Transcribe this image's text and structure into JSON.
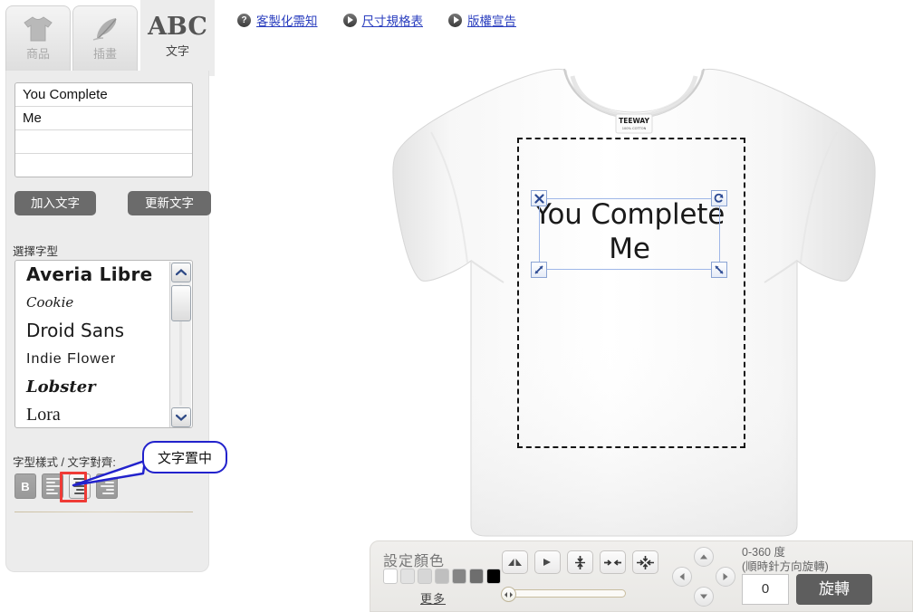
{
  "tabs": [
    {
      "id": "product",
      "label": "商品",
      "icon": "tshirt-icon",
      "active": false
    },
    {
      "id": "illustration",
      "label": "插畫",
      "icon": "feather-icon",
      "active": false
    },
    {
      "id": "text",
      "label": "文字",
      "icon": "abc-icon",
      "glyph": "ABC",
      "active": true
    }
  ],
  "top_links": [
    {
      "label": "客製化需知",
      "icon": "question-mark-icon"
    },
    {
      "label": "尺寸規格表",
      "icon": "play-icon"
    },
    {
      "label": "版權宣告",
      "icon": "play-icon"
    }
  ],
  "text_editor": {
    "lines": [
      "You Complete",
      "Me",
      "",
      ""
    ],
    "add_button": "加入文字",
    "update_button": "更新文字"
  },
  "font_section": {
    "label": "選擇字型",
    "fonts": [
      "Averia Libre",
      "Cookie",
      "Droid Sans",
      "Indie Flower",
      "Lobster",
      "Lora"
    ],
    "scroll_up": "▲",
    "scroll_down": "▼"
  },
  "style_section": {
    "label": "字型樣式 / 文字對齊:",
    "bold_label": "B",
    "buttons": [
      "bold",
      "align-left",
      "align-center",
      "align-right"
    ],
    "selected": "align-center",
    "tooltip": "文字置中",
    "highlight_color": "#ef3b36",
    "tooltip_border_color": "#2222cc"
  },
  "canvas": {
    "design_text_line1": "You Complete",
    "design_text_line2": "Me",
    "handles": {
      "close": "✕",
      "rotate": "↻",
      "resize_bl": "⤡",
      "resize_br": "⤢"
    },
    "print_area_style": "dashed"
  },
  "bottom_bar": {
    "color_label": "設定顏色",
    "more_label": "更多",
    "swatches": [
      "#ffffff",
      "#e2e2e2",
      "#d6d6d6",
      "#bfbfbf",
      "#858585",
      "#6e6e6e",
      "#000000"
    ],
    "tools": [
      {
        "name": "flip-horizontal-icon"
      },
      {
        "name": "flip-vertical-icon"
      },
      {
        "name": "center-vertical-icon"
      },
      {
        "name": "center-horizontal-icon"
      },
      {
        "name": "center-both-icon"
      }
    ],
    "dpad": {
      "up": "▲",
      "down": "▼",
      "left": "◀",
      "right": "▶"
    },
    "rotation_hint_line1": "0-360 度",
    "rotation_hint_line2": "(順時針方向旋轉)",
    "rotation_value": "0",
    "rotate_button": "旋轉"
  }
}
